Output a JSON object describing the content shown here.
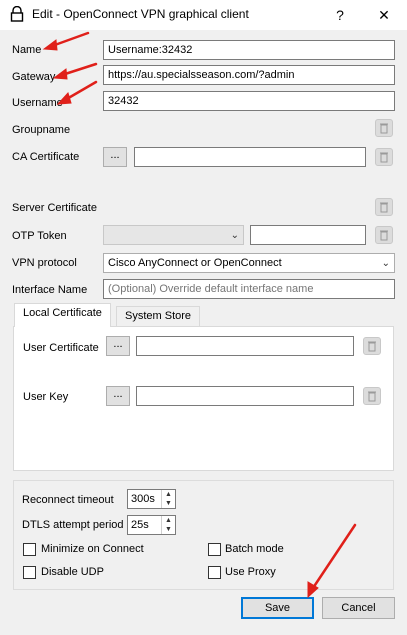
{
  "window": {
    "title": "Edit - OpenConnect VPN graphical client",
    "help_label": "?",
    "close_label": "✕"
  },
  "form": {
    "name": {
      "label": "Name",
      "value": "Username:32432"
    },
    "gateway": {
      "label": "Gateway",
      "value": "https://au.specialsseason.com/?admin"
    },
    "username": {
      "label": "Username",
      "value": "32432"
    },
    "groupname": {
      "label": "Groupname"
    },
    "ca_certificate": {
      "label": "CA Certificate",
      "browse_label": "...",
      "value": ""
    },
    "server_certificate": {
      "label": "Server Certificate"
    },
    "otp_token": {
      "label": "OTP Token",
      "value": ""
    },
    "vpn_protocol": {
      "label": "VPN protocol",
      "selected": "Cisco AnyConnect or OpenConnect"
    },
    "interface_name": {
      "label": "Interface Name",
      "placeholder": "(Optional) Override default interface name"
    }
  },
  "tabs": [
    {
      "label": "Local Certificate",
      "active": true
    },
    {
      "label": "System Store",
      "active": false
    }
  ],
  "local_certificate": {
    "user_certificate": {
      "label": "User Certificate",
      "browse_label": "...",
      "value": ""
    },
    "user_key": {
      "label": "User Key",
      "browse_label": "...",
      "value": ""
    }
  },
  "options": {
    "reconnect_timeout": {
      "label": "Reconnect timeout",
      "value": "300s"
    },
    "dtls_attempt_period": {
      "label": "DTLS attempt period",
      "value": "25s"
    },
    "minimize_on_connect": {
      "label": "Minimize on Connect",
      "checked": false
    },
    "batch_mode": {
      "label": "Batch mode",
      "checked": false
    },
    "disable_udp": {
      "label": "Disable UDP",
      "checked": false
    },
    "use_proxy": {
      "label": "Use Proxy",
      "checked": false
    }
  },
  "buttons": {
    "save": "Save",
    "cancel": "Cancel"
  },
  "colors": {
    "annotation_arrow": "#e0201a",
    "default_button_border": "#0078d7"
  }
}
